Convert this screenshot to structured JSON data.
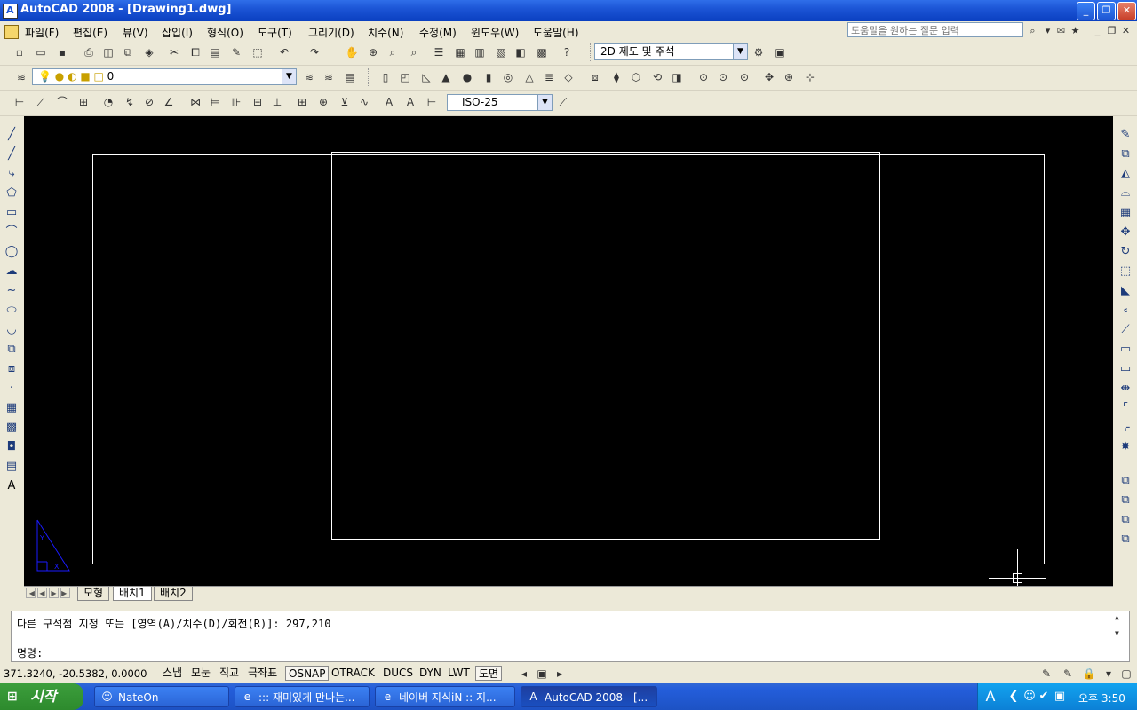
{
  "window": {
    "title": "AutoCAD 2008 - [Drawing1.dwg]"
  },
  "menu": [
    "파일(F)",
    "편집(E)",
    "뷰(V)",
    "삽입(I)",
    "형식(O)",
    "도구(T)",
    "그리기(D)",
    "치수(N)",
    "수정(M)",
    "윈도우(W)",
    "도움말(H)"
  ],
  "help_search": {
    "placeholder": "도움말을 원하는 질문 입력"
  },
  "workspace": {
    "value": "2D 제도 및 주석"
  },
  "layer": {
    "value": "0"
  },
  "dimstyle": {
    "value": "ISO-25"
  },
  "tabs": [
    "모형",
    "배치1",
    "배치2"
  ],
  "active_tab": "배치1",
  "command": {
    "history": "다른 구석점 지정 또는 [영역(A)/치수(D)/회전(R)]: 297,210",
    "prompt": "명령:"
  },
  "status": {
    "coords": "371.3240, -20.5382, 0.0000",
    "toggles": [
      {
        "label": "스냅",
        "on": false
      },
      {
        "label": "모눈",
        "on": false
      },
      {
        "label": "직교",
        "on": false
      },
      {
        "label": "극좌표",
        "on": false
      },
      {
        "label": "OSNAP",
        "on": true
      },
      {
        "label": "OTRACK",
        "on": false
      },
      {
        "label": "DUCS",
        "on": false
      },
      {
        "label": "DYN",
        "on": false
      },
      {
        "label": "LWT",
        "on": false
      },
      {
        "label": "도면",
        "on": true
      }
    ]
  },
  "taskbar": {
    "start": "시작",
    "tasks": [
      {
        "label": "NateOn",
        "icon": "nateon-icon",
        "active": false
      },
      {
        "label": "::: 재미있게 만나는...",
        "icon": "ie-icon",
        "active": false
      },
      {
        "label": "네이버 지식iN :: 지...",
        "icon": "ie-icon",
        "active": false
      },
      {
        "label": "AutoCAD 2008 - [...",
        "icon": "autocad-icon",
        "active": true
      }
    ],
    "clock": "오후 3:50"
  },
  "colors": {
    "canvas": "#000000",
    "paper_border": "#ffffff",
    "ucs_icon": "#1a1aff",
    "taskbar": "#245edb"
  }
}
